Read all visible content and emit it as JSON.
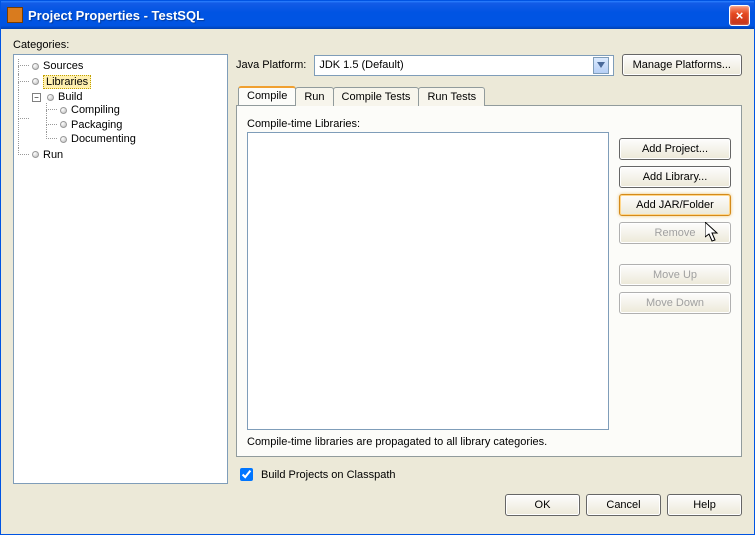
{
  "window": {
    "title": "Project Properties - TestSQL",
    "close_glyph": "×"
  },
  "categories": {
    "label": "Categories:",
    "items": {
      "sources": "Sources",
      "libraries": "Libraries",
      "build": "Build",
      "compiling": "Compiling",
      "packaging": "Packaging",
      "documenting": "Documenting",
      "run": "Run"
    }
  },
  "platform": {
    "label": "Java Platform:",
    "value": "JDK 1.5 (Default)",
    "manage_btn": "Manage Platforms..."
  },
  "tabs": {
    "compile": "Compile",
    "run": "Run",
    "compile_tests": "Compile Tests",
    "run_tests": "Run Tests"
  },
  "compile_panel": {
    "group_label": "Compile-time Libraries:",
    "hint": "Compile-time libraries are propagated to all library categories.",
    "buttons": {
      "add_project": "Add Project...",
      "add_library": "Add Library...",
      "add_jar": "Add JAR/Folder",
      "remove": "Remove",
      "move_up": "Move Up",
      "move_down": "Move Down"
    }
  },
  "checkbox": {
    "label": "Build Projects on Classpath",
    "checked": true
  },
  "footer": {
    "ok": "OK",
    "cancel": "Cancel",
    "help": "Help"
  }
}
